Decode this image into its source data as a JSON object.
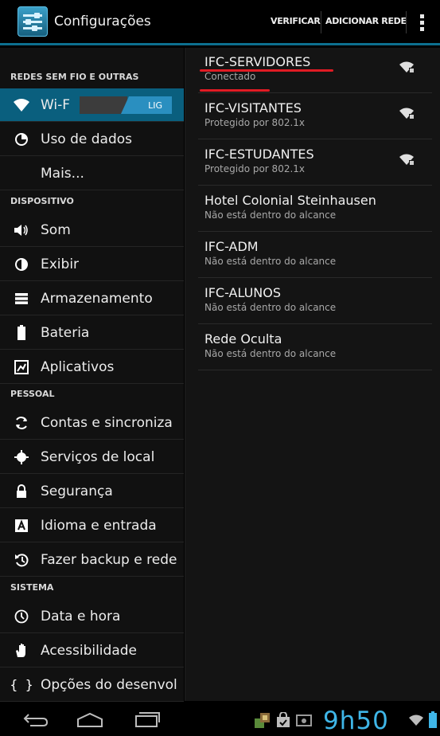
{
  "actionbar": {
    "title": "Configurações",
    "verify_label": "VERIFICAR",
    "add_network_label": "ADICIONAR REDE",
    "overflow_icon": "overflow-menu-icon"
  },
  "sidebar": {
    "sections": [
      {
        "label": "REDES SEM FIO E OUTRAS"
      },
      {
        "label": "DISPOSITIVO"
      },
      {
        "label": "PESSOAL"
      },
      {
        "label": "SISTEMA"
      }
    ],
    "wifi": {
      "label": "Wi-F",
      "toggle_label": "LIG"
    },
    "items": [
      {
        "label": "Uso de dados",
        "icon": "data-usage-icon"
      },
      {
        "label": "Mais...",
        "icon": ""
      },
      {
        "label": "Som",
        "icon": "speaker-icon"
      },
      {
        "label": "Exibir",
        "icon": "brightness-icon"
      },
      {
        "label": "Armazenamento",
        "icon": "storage-icon"
      },
      {
        "label": "Bateria",
        "icon": "battery-icon"
      },
      {
        "label": "Aplicativos",
        "icon": "apps-icon"
      },
      {
        "label": "Contas e sincroniza",
        "icon": "sync-icon"
      },
      {
        "label": "Serviços de local",
        "icon": "location-icon"
      },
      {
        "label": "Segurança",
        "icon": "lock-icon"
      },
      {
        "label": "Idioma e entrada",
        "icon": "keyboard-icon"
      },
      {
        "label": "Fazer backup e rede",
        "icon": "backup-icon"
      },
      {
        "label": "Data e hora",
        "icon": "clock-icon"
      },
      {
        "label": "Acessibilidade",
        "icon": "hand-icon"
      },
      {
        "label": "Opções do desenvol",
        "icon": "braces-icon"
      }
    ]
  },
  "networks": [
    {
      "ssid": "IFC-SERVIDORES",
      "status": "Conectado",
      "signal": "wifi-strong"
    },
    {
      "ssid": "IFC-VISITANTES",
      "status": "Protegido por 802.1x",
      "signal": "wifi-locked"
    },
    {
      "ssid": "IFC-ESTUDANTES",
      "status": "Protegido por 802.1x",
      "signal": "wifi-locked"
    },
    {
      "ssid": "Hotel Colonial Steinhausen",
      "status": "Não está dentro do alcance",
      "signal": ""
    },
    {
      "ssid": "IFC-ADM",
      "status": "Não está dentro do alcance",
      "signal": ""
    },
    {
      "ssid": "IFC-ALUNOS",
      "status": "Não está dentro do alcance",
      "signal": ""
    },
    {
      "ssid": "Rede Oculta",
      "status": "Não está dentro do alcance",
      "signal": ""
    }
  ],
  "statusbar": {
    "clock": "9h50",
    "icons": [
      "notification-app-icon",
      "shopping-bag-icon",
      "photo-icon",
      "wifi-status-icon",
      "battery-status-icon"
    ]
  },
  "colors": {
    "accent": "#0a5f7e",
    "toggle_on": "#2a8fc0",
    "annotation": "#e01b24",
    "clock": "#3fb6e8"
  }
}
